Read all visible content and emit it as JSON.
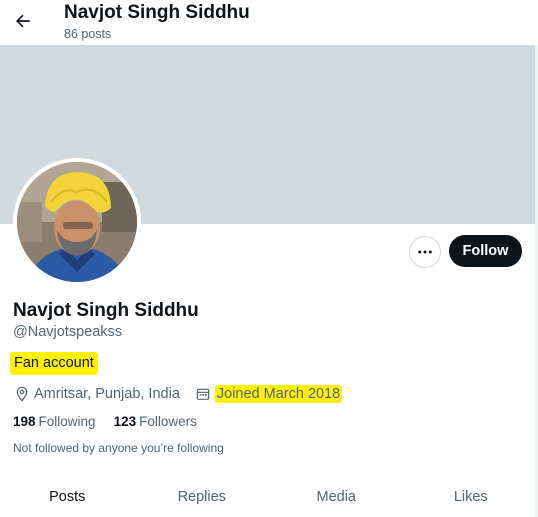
{
  "header": {
    "name": "Navjot Singh Siddhu",
    "posts_count": "86 posts"
  },
  "profile": {
    "display_name": "Navjot Singh Siddhu",
    "handle": "@Navjotspeakss",
    "bio": "Fan account",
    "location": "Amritsar, Punjab, India",
    "joined": "Joined March 2018",
    "following_count": "198",
    "following_label": "Following",
    "followers_count": "123",
    "followers_label": "Followers",
    "not_followed": "Not followed by anyone you’re following"
  },
  "actions": {
    "follow_label": "Follow",
    "more_icon": "more-icon"
  },
  "tabs": [
    {
      "label": "Posts",
      "active": true
    },
    {
      "label": "Replies",
      "active": false
    },
    {
      "label": "Media",
      "active": false
    },
    {
      "label": "Likes",
      "active": false
    }
  ],
  "colors": {
    "banner": "#cfd9de",
    "highlight": "#fff200",
    "follow_button": "#0f1419",
    "secondary_text": "#536471"
  },
  "icons": [
    "back-arrow-icon",
    "more-icon",
    "location-pin-icon",
    "calendar-icon"
  ]
}
